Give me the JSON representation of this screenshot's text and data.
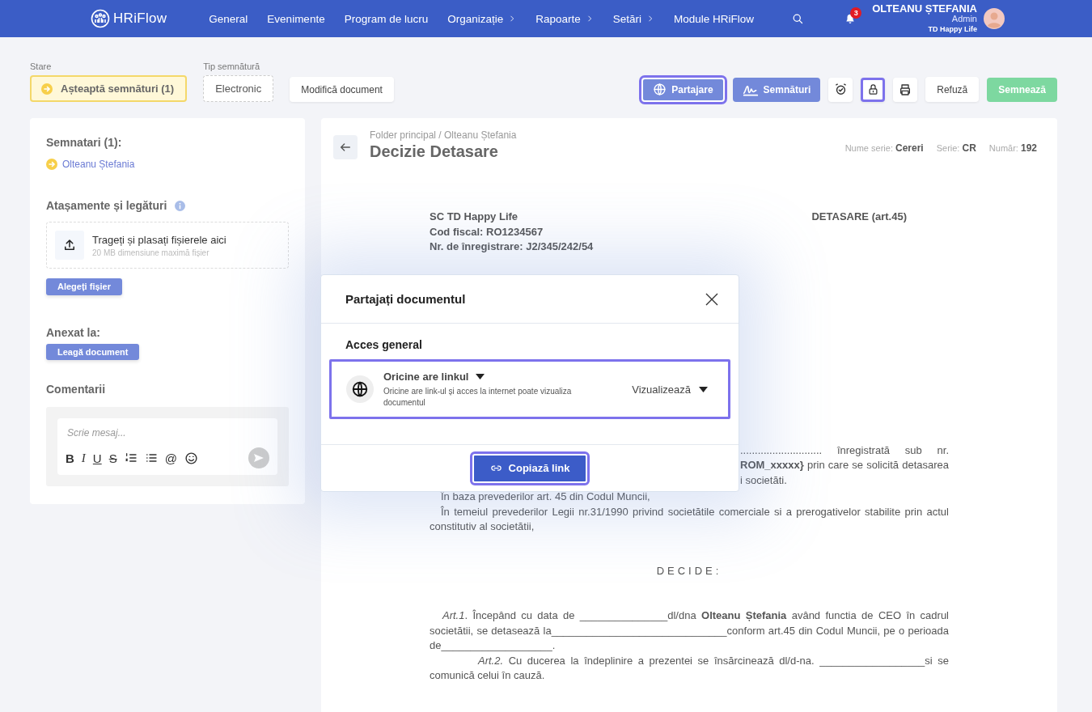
{
  "nav": {
    "brand": "HRiFlow",
    "items": [
      {
        "label": "General",
        "submenu": false
      },
      {
        "label": "Evenimente",
        "submenu": false
      },
      {
        "label": "Program de lucru",
        "submenu": false
      },
      {
        "label": "Organizație",
        "submenu": true
      },
      {
        "label": "Rapoarte",
        "submenu": true
      },
      {
        "label": "Setări",
        "submenu": true
      },
      {
        "label": "Module HRiFlow",
        "submenu": false
      }
    ],
    "notifications": "3",
    "user": {
      "name": "OLTEANU ȘTEFANIA",
      "role": "Admin",
      "company": "TD Happy Life"
    }
  },
  "toolbar": {
    "status": {
      "label": "Stare",
      "value": "Așteaptă semnături (1)"
    },
    "signature_type": {
      "label": "Tip semnătură",
      "value": "Electronic"
    },
    "edit_button": "Modifică document",
    "actions": [
      {
        "kind": "share",
        "label": "Partajare",
        "highlighted": true
      },
      {
        "kind": "signatures",
        "label": "Semnături",
        "highlighted": false
      },
      {
        "kind": "alarm",
        "highlighted": false
      },
      {
        "kind": "lock",
        "highlighted": true
      },
      {
        "kind": "print",
        "highlighted": false
      },
      {
        "kind": "refuse",
        "label": "Refuză",
        "highlighted": false
      },
      {
        "kind": "sign",
        "label": "Semnează",
        "highlighted": false
      }
    ]
  },
  "sidebar": {
    "signers_title": "Semnatari (1):",
    "signers": [
      "Olteanu Ștefania"
    ],
    "attachments_title": "Atașamente și legături",
    "dropzone": {
      "title": "Trageți și plasați fișierele aici",
      "hint": "20 MB dimensiune maximă fișier"
    },
    "choose_button": "Alegeți fișier",
    "annex_title": "Anexat la:",
    "link_button": "Leagă document",
    "comments_title": "Comentarii",
    "comment": {
      "placeholder": "Scrie mesaj...",
      "tools": [
        {
          "kind": "bold",
          "label": "B"
        },
        {
          "kind": "italic",
          "label": "I"
        },
        {
          "kind": "underline",
          "label": "U"
        },
        {
          "kind": "strike",
          "label": "S"
        },
        {
          "kind": "ordered_list"
        },
        {
          "kind": "bullet_list"
        },
        {
          "kind": "mention",
          "label": "@"
        },
        {
          "kind": "emoji"
        }
      ]
    }
  },
  "document": {
    "breadcrumb": "Folder principal / Olteanu Ștefania",
    "title": "Decizie Detasare",
    "meta": [
      {
        "label": "Nume serie:",
        "value": "Cereri"
      },
      {
        "label": "Serie:",
        "value": "CR"
      },
      {
        "label": "Număr:",
        "value": "192"
      }
    ],
    "company_lines": [
      "SC TD Happy Life",
      "Cod fiscal: RO1234567",
      "Nr. de înregistrare: J2/345/242/54"
    ],
    "heading": "DETASARE (art.45)",
    "blocks": [
      {
        "kind": "fragment",
        "text": "............................ înregistrată sub nr."
      },
      {
        "kind": "fragment",
        "text": "**ROM_xxxxx}** prin care se solicită detasarea"
      },
      {
        "kind": "fragment_end",
        "text": "i societăti."
      },
      {
        "kind": "paragraph",
        "text": "În baza prevederilor art. 45 din Codul Muncii,"
      },
      {
        "kind": "paragraph",
        "text": "În temeiul prevederilor Legii nr.31/1990 privind societătile comerciale si a prerogativelor stabilite prin actul constitutiv al societătii,"
      },
      {
        "kind": "center",
        "text": "DECIDE:"
      },
      {
        "kind": "article",
        "text": "*Art.1*. Începând cu data de _______________dl/dna **Olteanu Ștefania** având functia de CEO în cadrul societătii, se detasează la______________________________conform art.45 din Codul Muncii, pe o perioada de___________________."
      },
      {
        "kind": "article_indented",
        "text": "*Art.2.* Cu ducerea la îndeplinire a prezentei se însărcinează dl/d-na. __________________si se comunică celui în cauză."
      }
    ]
  },
  "share_dialog": {
    "title": "Partajați documentul",
    "section": "Acces general",
    "access": {
      "label": "Oricine are linkul",
      "description": "Oricine are link-ul și acces la internet poate vizualiza documentul",
      "permission": "Vizualizează",
      "highlighted": true
    },
    "copy_button": {
      "label": "Copiază link",
      "highlighted": true
    }
  }
}
